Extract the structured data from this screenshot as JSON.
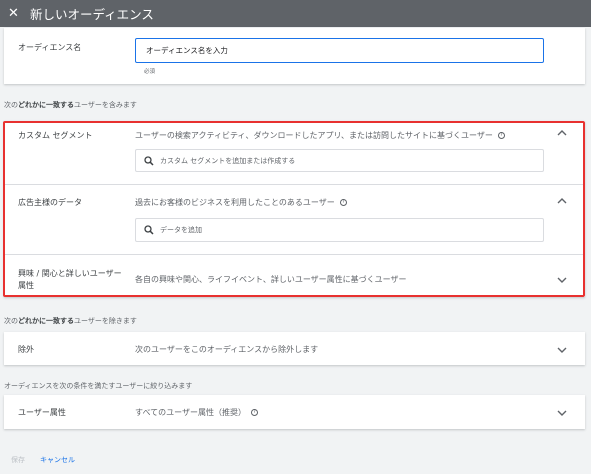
{
  "header": {
    "close_icon": "close-icon",
    "title": "新しいオーディエンス"
  },
  "audience_name": {
    "label": "オーディエンス名",
    "placeholder": "オーディエンス名を入力",
    "required": "必須"
  },
  "include_section": {
    "label_prefix": "次の",
    "label_bold": "どれかに一致する",
    "label_suffix": "ユーザーを含みます"
  },
  "custom_segment": {
    "label": "カスタム セグメント",
    "description": "ユーザーの検索アクティビティ、ダウンロードしたアプリ、または訪問したサイトに基づくユーザー",
    "search_placeholder": "カスタム セグメントを追加または作成する"
  },
  "advertiser_data": {
    "label": "広告主様のデータ",
    "description": "過去にお客様のビジネスを利用したことのあるユーザー",
    "search_placeholder": "データを追加"
  },
  "interests": {
    "label_line1": "興味 / 関心と詳しいユーザー",
    "label_line2": "属性",
    "description": "各自の興味や関心、ライフイベント、詳しいユーザー属性に基づくユーザー"
  },
  "exclude_section": {
    "label_prefix": "次の",
    "label_bold": "どれかに一致する",
    "label_suffix": "ユーザーを除きます"
  },
  "exclusion": {
    "label": "除外",
    "description": "次のユーザーをこのオーディエンスから除外します"
  },
  "narrow_section": {
    "label": "オーディエンスを次の条件を満たすユーザーに絞り込みます"
  },
  "demographics": {
    "label": "ユーザー属性",
    "description": "すべてのユーザー属性（推奨）"
  },
  "footer": {
    "save": "保存",
    "cancel": "キャンセル"
  },
  "colors": {
    "accent": "#1a73e8",
    "highlight": "#e8312f",
    "header": "#5f6368"
  }
}
